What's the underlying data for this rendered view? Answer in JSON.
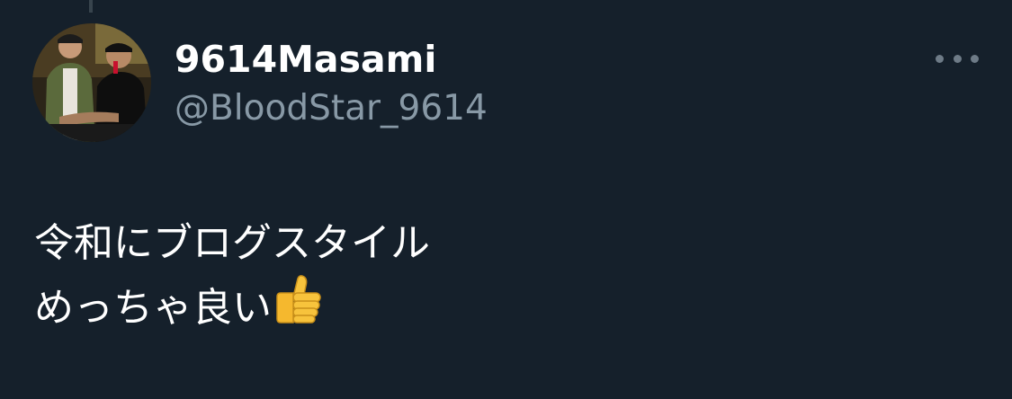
{
  "tweet": {
    "display_name": "9614Masami",
    "handle": "@BloodStar_9614",
    "text_line_1": "令和にブログスタイル",
    "text_line_2": "めっちゃ良い",
    "emoji": "thumbs-up-icon",
    "more_icon": "more-horizontal-icon"
  },
  "colors": {
    "background": "#15202b",
    "name": "#ffffff",
    "handle": "#8899a6",
    "text": "#ffffff"
  }
}
